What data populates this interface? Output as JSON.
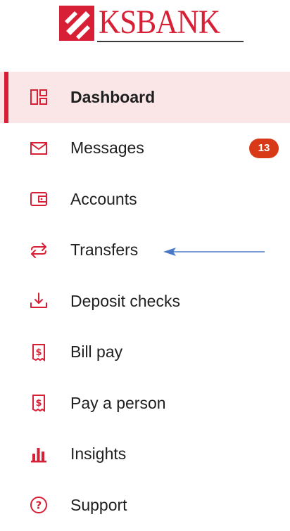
{
  "logo": {
    "text": "KSBANK",
    "color": "#d71f36"
  },
  "nav": {
    "accent_color": "#d71f36",
    "items": [
      {
        "label": "Dashboard",
        "icon": "dashboard-icon",
        "active": true
      },
      {
        "label": "Messages",
        "icon": "envelope-icon",
        "badge": "13"
      },
      {
        "label": "Accounts",
        "icon": "wallet-icon"
      },
      {
        "label": "Transfers",
        "icon": "transfer-arrows-icon"
      },
      {
        "label": "Deposit checks",
        "icon": "download-tray-icon"
      },
      {
        "label": "Bill pay",
        "icon": "receipt-dollar-icon"
      },
      {
        "label": "Pay a person",
        "icon": "receipt-dollar-icon"
      },
      {
        "label": "Insights",
        "icon": "bar-chart-icon"
      },
      {
        "label": "Support",
        "icon": "question-circle-icon"
      }
    ]
  },
  "annotation": {
    "arrow_color": "#4a78c8"
  }
}
